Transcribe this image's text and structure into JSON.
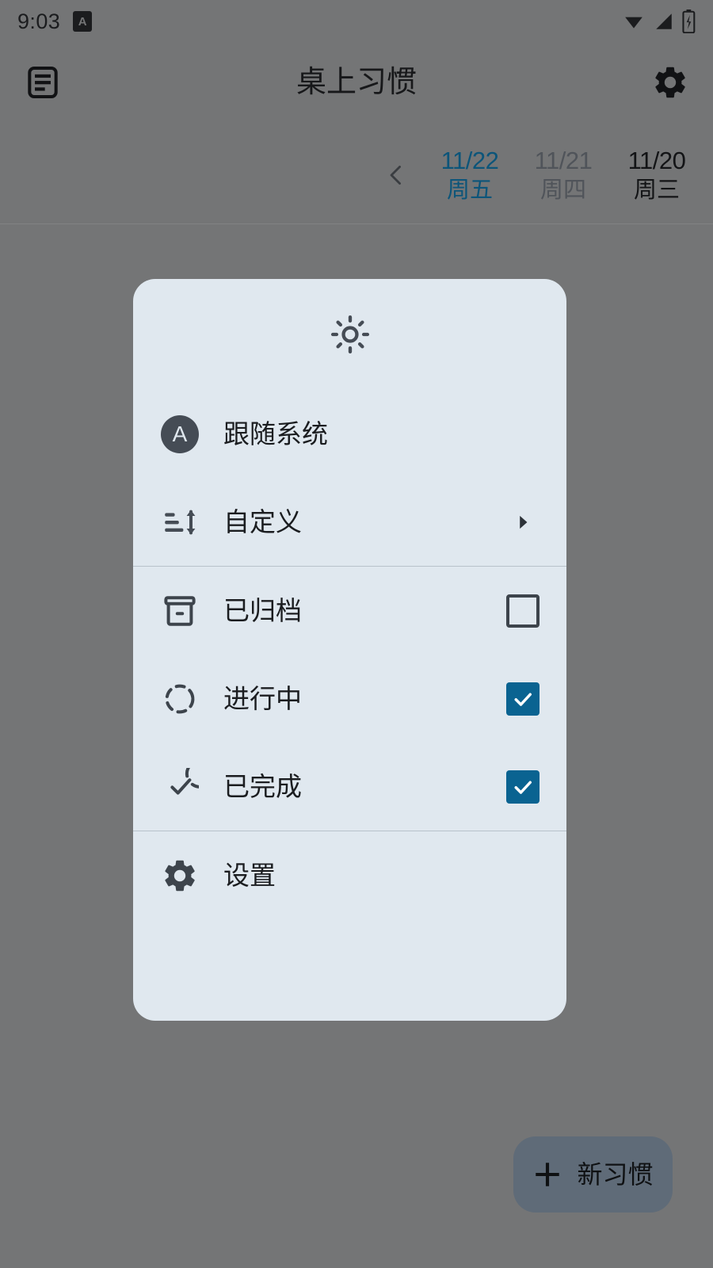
{
  "status_bar": {
    "clock": "9:03",
    "notification_badge": "A",
    "icons": [
      "wifi-icon",
      "cellular-signal-icon",
      "battery-charging-icon"
    ]
  },
  "app_bar": {
    "title": "桌上习惯",
    "left_icon": "article-list-icon",
    "right_icon": "gear-icon"
  },
  "date_strip": {
    "prev_icon": "chevron-left-icon",
    "days": [
      {
        "date": "11/22",
        "weekday": "周五",
        "state": "selected"
      },
      {
        "date": "11/21",
        "weekday": "周四",
        "state": "muted"
      },
      {
        "date": "11/20",
        "weekday": "周三",
        "state": "normal"
      }
    ]
  },
  "fab": {
    "icon": "plus-icon",
    "label": "新习惯"
  },
  "menu": {
    "header_icon": "brightness-sun-icon",
    "accent_color": "#0a6391",
    "card_color": "#e0e8ef",
    "groups": [
      {
        "items": [
          {
            "label": "跟随系统",
            "icon": "circle-a-auto-icon",
            "trailing": "none"
          },
          {
            "label": "自定义",
            "icon": "sort-size-icon",
            "trailing": "chevron-right-icon"
          }
        ]
      },
      {
        "items": [
          {
            "label": "已归档",
            "icon": "archive-icon",
            "trailing": "checkbox",
            "checked": false
          },
          {
            "label": "进行中",
            "icon": "dashed-circle-icon",
            "trailing": "checkbox",
            "checked": true
          },
          {
            "label": "已完成",
            "icon": "check-circle-icon",
            "trailing": "checkbox",
            "checked": true
          }
        ]
      },
      {
        "items": [
          {
            "label": "设置",
            "icon": "gear-icon",
            "trailing": "none"
          }
        ]
      }
    ]
  }
}
